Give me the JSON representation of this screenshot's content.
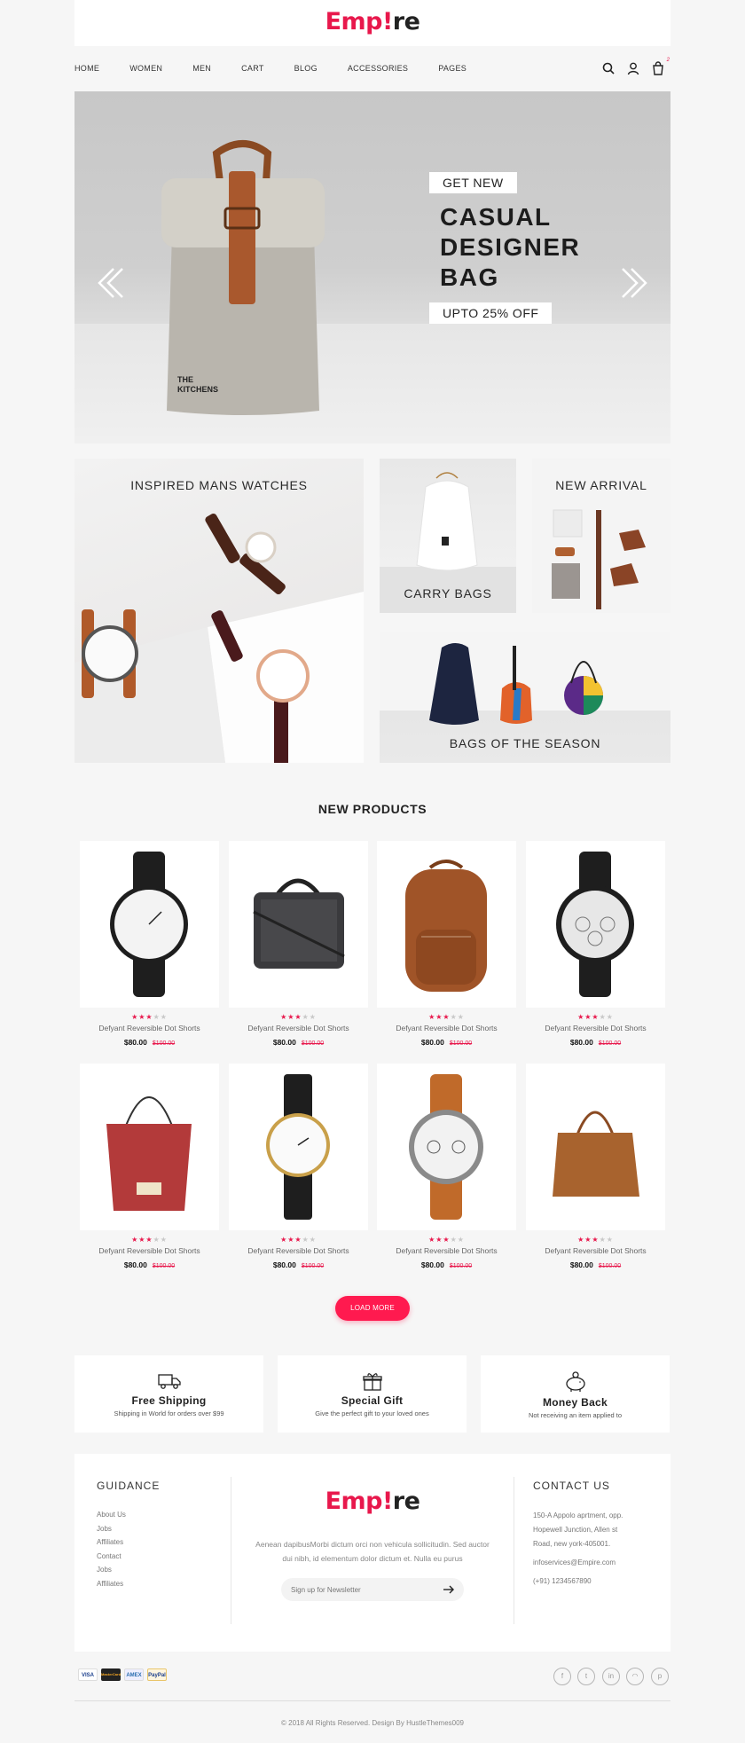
{
  "brand": {
    "e": "Emp",
    "bang": "!",
    "rest": "re"
  },
  "nav": {
    "items": [
      "HOME",
      "WOMEN",
      "MEN",
      "CART",
      "BLOG",
      "ACCESSORIES",
      "PAGES"
    ],
    "cart_count": "2"
  },
  "hero": {
    "tag": "GET NEW",
    "title_lines": [
      "CASUAL",
      "DESIGNER",
      "BAG"
    ],
    "offer": "UPTO 25% OFF",
    "product_print": [
      "THE",
      "KITCHENS"
    ]
  },
  "banners": {
    "watches": "INSPIRED MANS WATCHES",
    "carry": "CARRY BAGS",
    "arrival": "NEW ARRIVAL",
    "season": "BAGS OF THE SEASON"
  },
  "new_products": {
    "title": "NEW PRODUCTS",
    "items": [
      {
        "name": "Defyant Reversible Dot Shorts",
        "price": "$80.00",
        "old_price": "$100.00",
        "rating": 3,
        "image": "white-dial-watch"
      },
      {
        "name": "Defyant Reversible Dot Shorts",
        "price": "$80.00",
        "old_price": "$100.00",
        "rating": 3,
        "image": "checkered-laptop-bag"
      },
      {
        "name": "Defyant Reversible Dot Shorts",
        "price": "$80.00",
        "old_price": "$100.00",
        "rating": 3,
        "image": "leather-backpack"
      },
      {
        "name": "Defyant Reversible Dot Shorts",
        "price": "$80.00",
        "old_price": "$100.00",
        "rating": 3,
        "image": "chronograph-watch"
      },
      {
        "name": "Defyant Reversible Dot Shorts",
        "price": "$80.00",
        "old_price": "$100.00",
        "rating": 3,
        "image": "red-tote-bag"
      },
      {
        "name": "Defyant Reversible Dot Shorts",
        "price": "$80.00",
        "old_price": "$100.00",
        "rating": 3,
        "image": "gold-minimal-watch"
      },
      {
        "name": "Defyant Reversible Dot Shorts",
        "price": "$80.00",
        "old_price": "$100.00",
        "rating": 3,
        "image": "fossil-leather-watch"
      },
      {
        "name": "Defyant Reversible Dot Shorts",
        "price": "$80.00",
        "old_price": "$100.00",
        "rating": 3,
        "image": "tan-handbag"
      }
    ],
    "load_more": "LOAD MORE"
  },
  "features": [
    {
      "title": "Free Shipping",
      "desc": "Shipping in World for orders over $99",
      "icon": "truck-icon"
    },
    {
      "title": "Special Gift",
      "desc": "Give the perfect gift to your loved ones",
      "icon": "gift-icon"
    },
    {
      "title": "Money Back",
      "desc": "Not receiving an item applied to",
      "icon": "piggy-bank-icon"
    }
  ],
  "footer": {
    "guidance_title": "GUIDANCE",
    "guidance_links": [
      "About Us",
      "Jobs",
      "Affiliates",
      "Contact",
      "Jobs",
      "Affiliates"
    ],
    "description": "Aenean dapibusMorbi dictum orci non vehicula sollicitudin. Sed auctor dui nibh, id elementum dolor dictum et. Nulla eu purus",
    "newsletter_placeholder": "Sign up for Newsletter",
    "contact_title": "CONTACT US",
    "address_lines": [
      "150-A Appolo aprtment, opp.",
      "Hopewell Junction, Allen st",
      "Road, new york-405001."
    ],
    "email": "infoservices@Empire.com",
    "phone": "(+91) 1234567890"
  },
  "payments": [
    "VISA",
    "MasterCard",
    "AMEX",
    "PayPal"
  ],
  "social": [
    {
      "icon": "facebook-icon",
      "glyph": "f"
    },
    {
      "icon": "twitter-icon",
      "glyph": "t"
    },
    {
      "icon": "linkedin-icon",
      "glyph": "in"
    },
    {
      "icon": "rss-icon",
      "glyph": "◠"
    },
    {
      "icon": "pinterest-icon",
      "glyph": "p"
    }
  ],
  "copyright": "© 2018 All Rights Reserved. Design By HustleThemes009",
  "colors": {
    "accent": "#e8184c",
    "button": "#ff1a4f",
    "background": "#f6f6f6"
  }
}
